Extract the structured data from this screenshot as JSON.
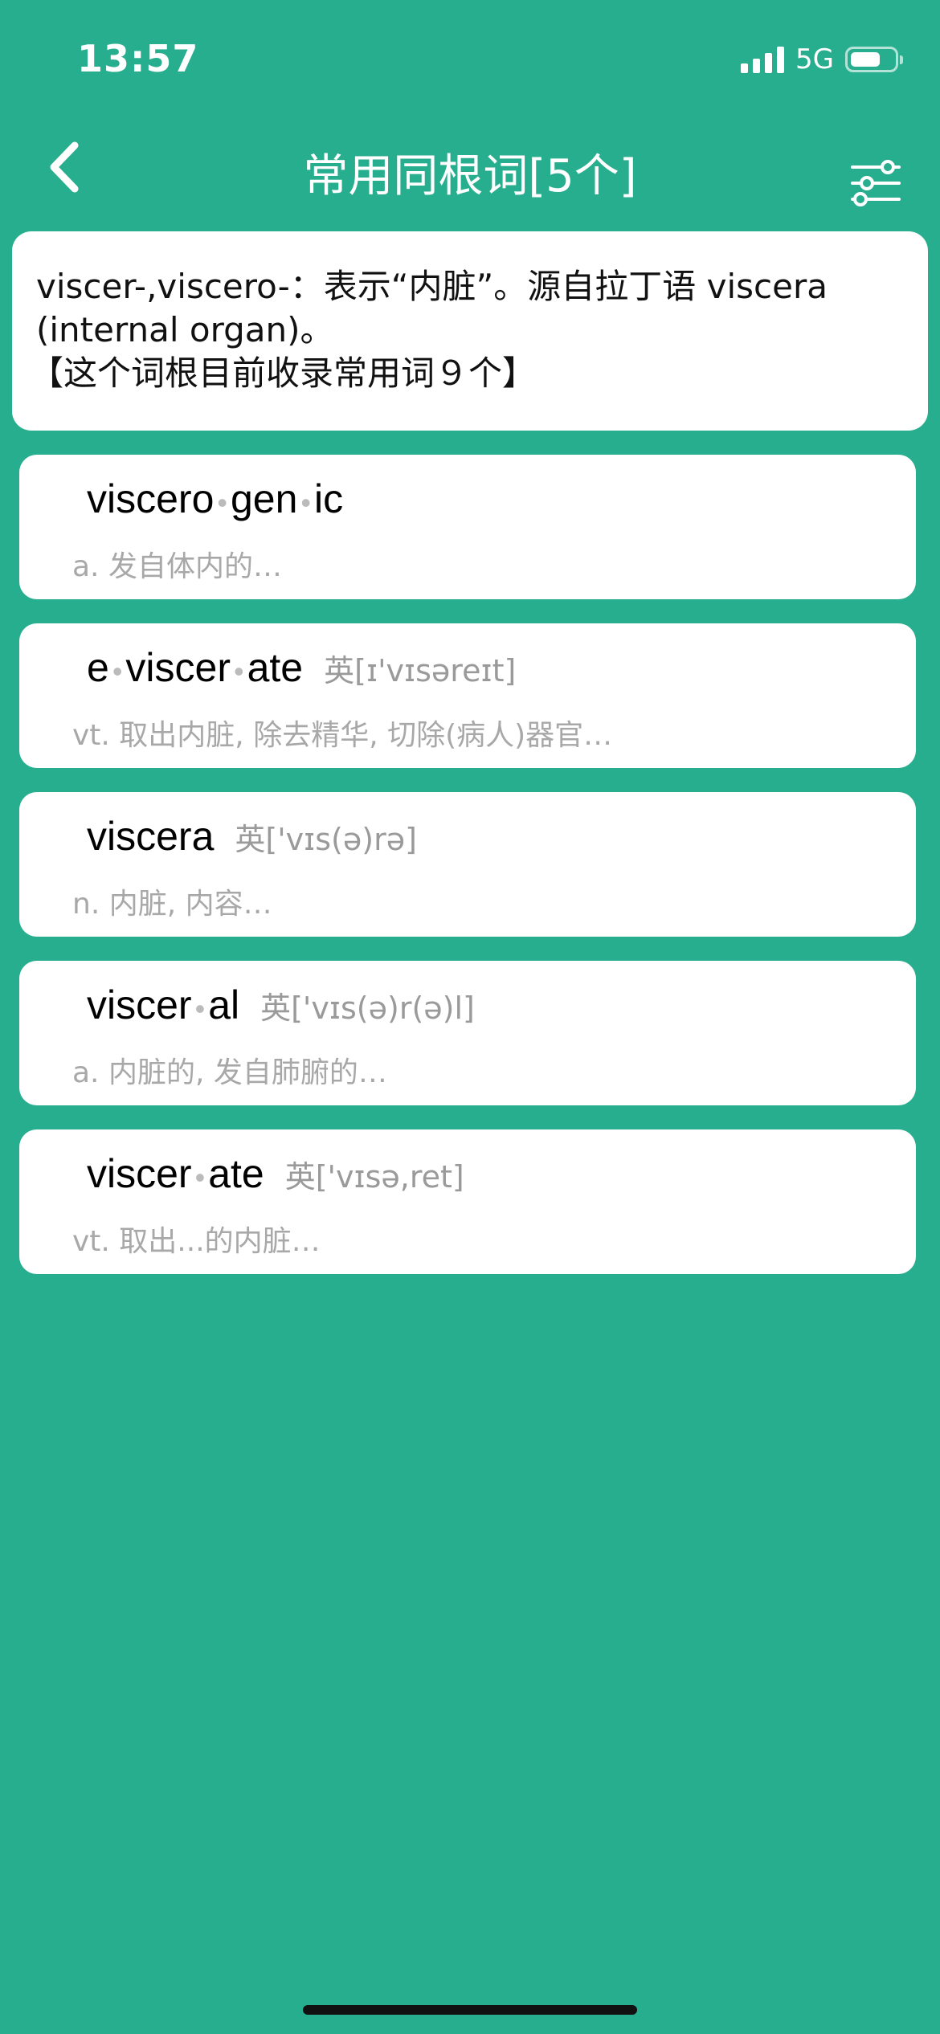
{
  "status_bar": {
    "time": "13:57",
    "network": "5G",
    "signal_icon": "cellular-signal-icon",
    "battery_icon": "battery-icon",
    "battery_level": 0.7
  },
  "nav": {
    "title": "常用同根词[5个]",
    "back_icon": "chevron-left-icon",
    "filter_icon": "sliders-icon"
  },
  "root": {
    "description": "viscer-,viscero-：表示“内脏”。源自拉丁语 viscera (internal organ)。",
    "count_text": "【这个词根目前收录常用词９个】"
  },
  "words": [
    {
      "parts": [
        "viscero",
        "gen",
        "ic"
      ],
      "phonetic": "",
      "definition": "a. 发自体内的…"
    },
    {
      "parts": [
        "e",
        "viscer",
        "ate"
      ],
      "phonetic": "英[ɪ'vɪsəreɪt]",
      "definition": "vt. 取出内脏, 除去精华, 切除(病人)器官…"
    },
    {
      "parts": [
        "viscera"
      ],
      "phonetic": "英['vɪs(ə)rə]",
      "definition": "n. 内脏, 内容…"
    },
    {
      "parts": [
        "viscer",
        "al"
      ],
      "phonetic": "英['vɪs(ə)r(ə)l]",
      "definition": "a. 内脏的, 发自肺腑的…"
    },
    {
      "parts": [
        "viscer",
        "ate"
      ],
      "phonetic": "英['vɪsə,ret]",
      "definition": "vt. 取出...的内脏…"
    }
  ],
  "colors": {
    "background": "#27AE8E",
    "card": "#FFFFFF",
    "secondary_text": "#A8A8A8"
  }
}
